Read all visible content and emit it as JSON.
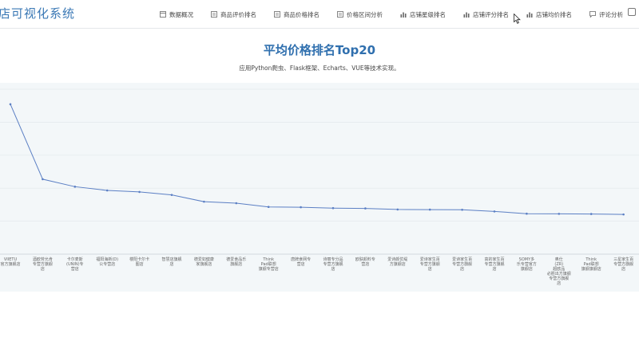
{
  "app": {
    "title": "店可视化系统"
  },
  "nav": {
    "items": [
      {
        "label": "数据概况",
        "icon": "doc-icon"
      },
      {
        "label": "商品评价排名",
        "icon": "list-icon"
      },
      {
        "label": "商品价格排名",
        "icon": "list-icon"
      },
      {
        "label": "价格区间分析",
        "icon": "list-icon"
      },
      {
        "label": "店铺星级排名",
        "icon": "bar-icon"
      },
      {
        "label": "店铺评分排名",
        "icon": "bar-icon"
      },
      {
        "label": "店铺均价排名",
        "icon": "bar-icon"
      },
      {
        "label": "评论分析",
        "icon": "comment-icon"
      }
    ]
  },
  "page": {
    "title": "平均价格排名Top20",
    "subtitle": "应用Python爬虫、Flask框架、Echarts、VUE等技术实现。"
  },
  "colors": {
    "line": "#5b7fc4",
    "accent": "#2f6fae",
    "panel": "#f3f7f9"
  },
  "chart_data": {
    "type": "line",
    "categories": [
      "VIIETU 官方旗舰店",
      "酒欧劳允肯 专营方旗舰 店",
      "卡尔麦斯 (UNIN)专 营店",
      "福阳海新(D) 公专营店",
      "楼阳卡尔卡 图店",
      "智慧店旗舰 店",
      "德爱如健康 家旗舰店",
      "德爱食品乐 旗舰店",
      "Think Pad联想 旗舰专营店",
      "唐牌食网专 营店",
      "诗丽专分品 专营方旗舰 店",
      "欧肤颜料专 营店",
      "爱诗颜优缇 方旗舰店",
      "爱诗家生百 专营方旗舰 店",
      "爱诗家生百 专营方旗舰 店",
      "高的家生百 专营方旗舰 店",
      "SOMY多 乐专营官方 旗舰店",
      "奥仕 (ZR) 超欧品 必胜出方旗舰 专营方旗舰 店",
      "Think Pad联想 旗舰旗舰店",
      "三星家生百 专营方旗舰 店"
    ],
    "values": [
      100,
      50,
      45,
      42.5,
      41.5,
      39.5,
      35,
      34,
      31.5,
      31.3,
      30.7,
      30.5,
      29.8,
      29.7,
      29.6,
      28.5,
      27,
      26.9,
      26.8,
      26.5
    ],
    "ylim": [
      0,
      110
    ],
    "grid": true,
    "series": [
      {
        "values": [
          100,
          50,
          45,
          42.5,
          41.5,
          39.5,
          35,
          34,
          31.5,
          31.3,
          30.7,
          30.5,
          29.8,
          29.7,
          29.6,
          28.5,
          27,
          26.9,
          26.8,
          26.5
        ]
      }
    ]
  }
}
